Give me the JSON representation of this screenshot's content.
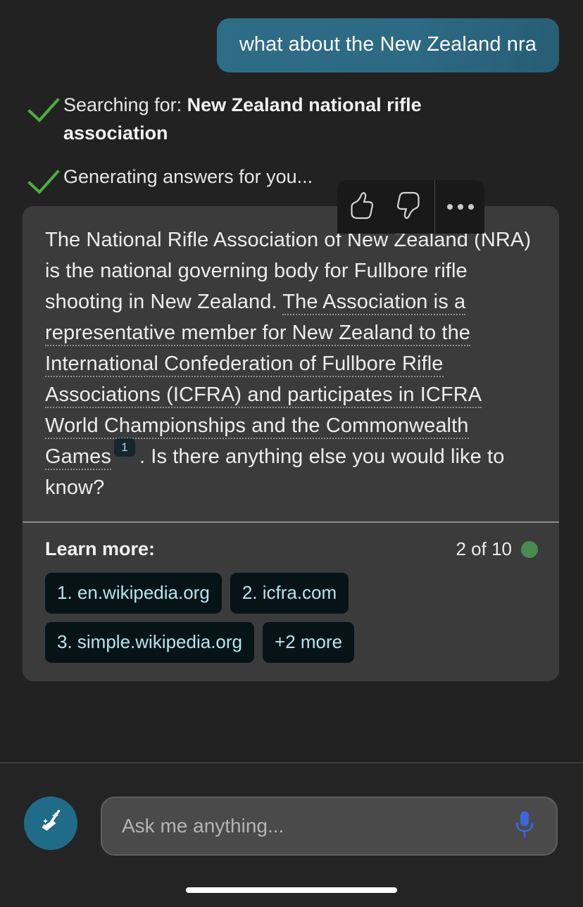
{
  "conversation": {
    "user_message": "what about the New Zealand nra",
    "status_lines": [
      {
        "icon": "check-icon",
        "prefix": "Searching for: ",
        "query": "New Zealand national rifle association"
      },
      {
        "icon": "check-icon",
        "prefix": "Generating answers for you...",
        "query": ""
      }
    ],
    "feedback": {
      "thumbs_up": "thumbs-up-icon",
      "thumbs_down": "thumbs-down-icon",
      "more": "more-options-icon"
    },
    "answer": {
      "segments": [
        {
          "text": "The National Rifle Association of New Zealand (NRA) is the national governing body for Fullbore rifle shooting in New Zealand. ",
          "cited": false
        },
        {
          "text": "The Association is a representative member for New Zealand to the International Confederation of Fullbore Rifle Associations (ICFRA) and participates in ICFRA World Championships and the Commonwealth Games",
          "cited": true
        },
        {
          "badge": "1"
        },
        {
          "text": ". Is there anything else you would like to know?",
          "cited": false
        }
      ],
      "full_text": "The National Rifle Association of New Zealand (NRA) is the national governing body for Fullbore rifle shooting in New Zealand. The Association is a representative member for New Zealand to the International Confederation of Fullbore Rifle Associations (ICFRA) and participates in ICFRA World Championships and the Commonwealth Games 1 . Is there anything else you would like to know?"
    },
    "sources": {
      "label": "Learn more:",
      "counter": "2 of 10",
      "status_color": "#4a8b4f",
      "chips": [
        "1. en.wikipedia.org",
        "2. icfra.com",
        "3. simple.wikipedia.org",
        "+2 more"
      ]
    }
  },
  "composer": {
    "clear_icon": "broom-icon",
    "placeholder": "Ask me anything...",
    "value": "",
    "mic_icon": "microphone-icon"
  },
  "colors": {
    "page_background": "#222222",
    "user_bubble": "#2d6a84",
    "answer_card": "#3b3b3b",
    "chip_background": "#071417",
    "chip_text": "#b9e3ee",
    "check_green": "#4caf3f",
    "status_green": "#4a8b4f",
    "mic_blue": "#3a67de",
    "broom_teal": "#206b87"
  }
}
